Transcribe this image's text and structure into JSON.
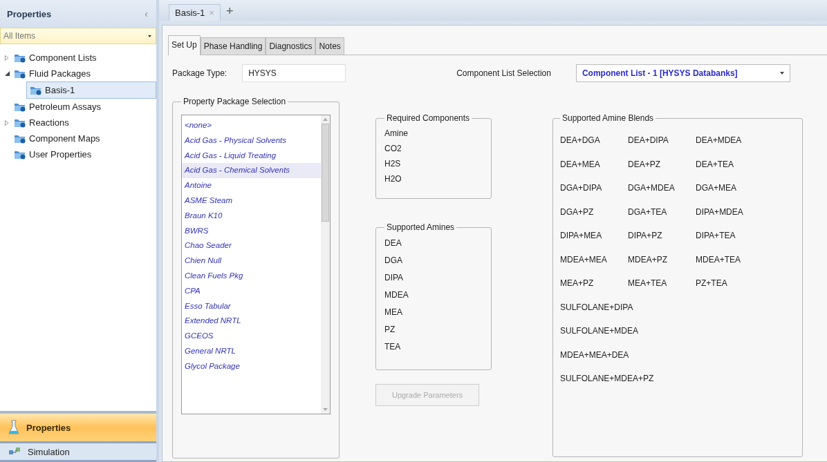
{
  "sidebar": {
    "title": "Properties",
    "collapse_glyph": "‹",
    "filter": {
      "value": "All Items"
    },
    "tree": [
      {
        "label": "Component Lists",
        "expanded": false,
        "selected": false
      },
      {
        "label": "Fluid Packages",
        "expanded": true,
        "selected": false,
        "children": [
          {
            "label": "Basis-1",
            "selected": true
          }
        ]
      },
      {
        "label": "Petroleum Assays",
        "selected": false
      },
      {
        "label": "Reactions",
        "expanded": false,
        "selected": false
      },
      {
        "label": "Component Maps",
        "selected": false
      },
      {
        "label": "User Properties",
        "selected": false
      }
    ],
    "nav": [
      {
        "label": "Properties",
        "selected": true
      },
      {
        "label": "Simulation",
        "selected": false
      }
    ]
  },
  "doc_tabs": [
    {
      "label": "Basis-1",
      "close": "×"
    }
  ],
  "new_tab": "+",
  "tabs": [
    {
      "label": "Set Up",
      "selected": true
    },
    {
      "label": "Phase Handling",
      "selected": false
    },
    {
      "label": "Diagnostics",
      "selected": false
    },
    {
      "label": "Notes",
      "selected": false
    }
  ],
  "package_type": {
    "label": "Package Type:",
    "value": "HYSYS"
  },
  "component_list": {
    "label": "Component List Selection",
    "value": "Component List - 1 [HYSYS Databanks]"
  },
  "property_package": {
    "title": "Property Package Selection",
    "items": [
      {
        "label": "<none>",
        "selected": false
      },
      {
        "label": "Acid Gas - Physical Solvents",
        "selected": false
      },
      {
        "label": "Acid Gas - Liquid Treating",
        "selected": false
      },
      {
        "label": "Acid Gas - Chemical Solvents",
        "selected": true
      },
      {
        "label": "Antoine",
        "selected": false
      },
      {
        "label": "ASME Steam",
        "selected": false
      },
      {
        "label": "Braun K10",
        "selected": false
      },
      {
        "label": "BWRS",
        "selected": false
      },
      {
        "label": "Chao Seader",
        "selected": false
      },
      {
        "label": "Chien Null",
        "selected": false
      },
      {
        "label": "Clean Fuels Pkg",
        "selected": false
      },
      {
        "label": "CPA",
        "selected": false
      },
      {
        "label": "Esso Tabular",
        "selected": false
      },
      {
        "label": "Extended NRTL",
        "selected": false
      },
      {
        "label": "GCEOS",
        "selected": false
      },
      {
        "label": "General NRTL",
        "selected": false
      },
      {
        "label": "Glycol Package",
        "selected": false
      }
    ]
  },
  "required_components": {
    "title": "Required Components",
    "items": [
      "Amine",
      "CO2",
      "H2S",
      "H2O"
    ]
  },
  "supported_amines": {
    "title": "Supported Amines",
    "items": [
      "DEA",
      "DGA",
      "DIPA",
      "MDEA",
      "MEA",
      "PZ",
      "TEA"
    ]
  },
  "upgrade_button": {
    "label": "Upgrade Parameters",
    "disabled": true
  },
  "amine_blends": {
    "title": "Supported Amine Blends",
    "rows": [
      [
        "DEA+DGA",
        "DEA+DIPA",
        "DEA+MDEA"
      ],
      [
        "DEA+MEA",
        "DEA+PZ",
        "DEA+TEA"
      ],
      [
        "DGA+DIPA",
        "DGA+MDEA",
        "DGA+MEA"
      ],
      [
        "DGA+PZ",
        "DGA+TEA",
        "DIPA+MDEA"
      ],
      [
        "DIPA+MEA",
        "DIPA+PZ",
        "DIPA+TEA"
      ],
      [
        "MDEA+MEA",
        "MDEA+PZ",
        "MDEA+TEA"
      ],
      [
        "MEA+PZ",
        "MEA+TEA",
        "PZ+TEA"
      ],
      [
        "SULFOLANE+DIPA"
      ],
      [
        "SULFOLANE+MDEA"
      ],
      [
        "MDEA+MEA+DEA"
      ],
      [
        "SULFOLANE+MDEA+PZ"
      ]
    ]
  }
}
